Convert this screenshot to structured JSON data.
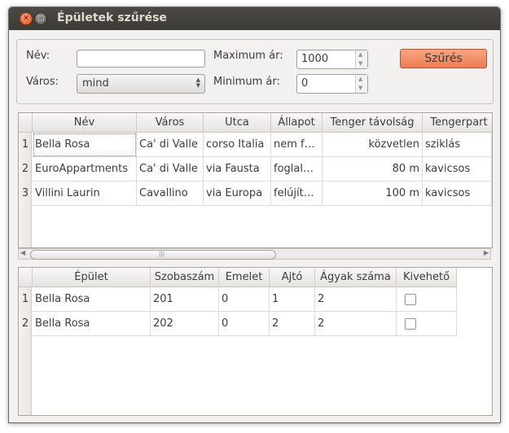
{
  "window": {
    "title": "Épületek szűrése"
  },
  "filter": {
    "name_label": "Név:",
    "name_value": "",
    "city_label": "Város:",
    "city_value": "mind",
    "max_price_label": "Maximum ár:",
    "max_price_value": "1000",
    "min_price_label": "Minimum ár:",
    "min_price_value": "0",
    "filter_button": "Szűrés"
  },
  "buildings": {
    "columns": [
      "Név",
      "Város",
      "Utca",
      "Állapot",
      "Tenger távolság",
      "Tengerpart"
    ],
    "rows": [
      {
        "num": "1",
        "name": "Bella Rosa",
        "city": "Ca' di Valle",
        "street": "corso Italia",
        "state": "nem f…",
        "sea_distance": "közvetlen",
        "beach": "sziklás"
      },
      {
        "num": "2",
        "name": "EuroAppartments",
        "city": "Ca' di Valle",
        "street": "via Fausta",
        "state": "foglal…",
        "sea_distance": "80 m",
        "beach": "kavicsos"
      },
      {
        "num": "3",
        "name": "Villini Laurin",
        "city": "Cavallino",
        "street": "via Europa",
        "state": "felújít…",
        "sea_distance": "100 m",
        "beach": "kavicsos"
      }
    ]
  },
  "rooms": {
    "columns": [
      "Épület",
      "Szobaszám",
      "Emelet",
      "Ajtó",
      "Ágyak száma",
      "Kivehető"
    ],
    "rows": [
      {
        "num": "1",
        "building": "Bella Rosa",
        "room": "201",
        "floor": "0",
        "door": "1",
        "beds": "2",
        "rentable": false
      },
      {
        "num": "2",
        "building": "Bella Rosa",
        "room": "202",
        "floor": "0",
        "door": "2",
        "beds": "2",
        "rentable": false
      }
    ]
  }
}
